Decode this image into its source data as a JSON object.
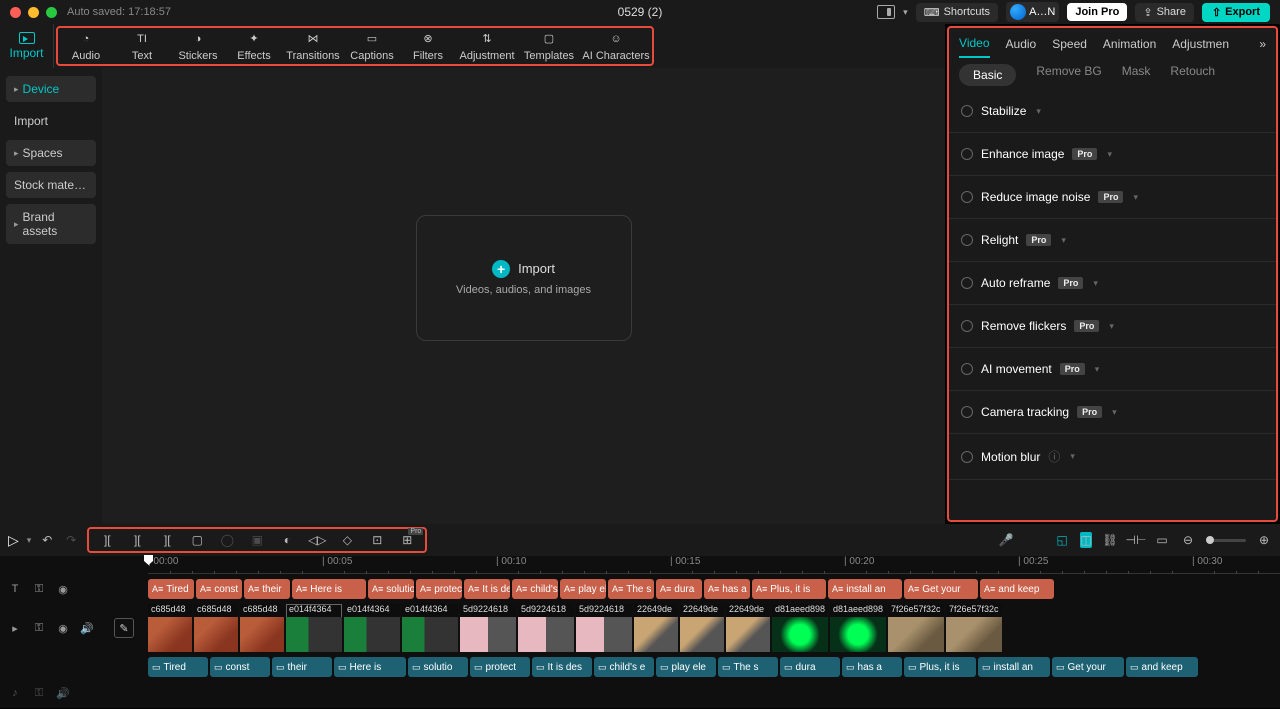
{
  "titlebar": {
    "autosave": "Auto saved: 17:18:57",
    "title": "0529 (2)",
    "shortcuts": "Shortcuts",
    "user": "A…N",
    "joinpro": "Join Pro",
    "share": "Share",
    "export": "Export"
  },
  "ribbon": {
    "import": "Import",
    "items": [
      {
        "label": "Audio"
      },
      {
        "label": "Text"
      },
      {
        "label": "Stickers"
      },
      {
        "label": "Effects"
      },
      {
        "label": "Transitions"
      },
      {
        "label": "Captions"
      },
      {
        "label": "Filters"
      },
      {
        "label": "Adjustment"
      },
      {
        "label": "Templates"
      },
      {
        "label": "AI Characters"
      }
    ]
  },
  "sidebar": {
    "items": [
      {
        "label": "Device",
        "active": true,
        "arrow": true
      },
      {
        "label": "Import",
        "plain": true
      },
      {
        "label": "Spaces",
        "arrow": true
      },
      {
        "label": "Stock mate…"
      },
      {
        "label": "Brand assets",
        "arrow": true
      }
    ]
  },
  "drop": {
    "title": "Import",
    "sub": "Videos, audios, and images"
  },
  "rightpanel": {
    "tabs": [
      "Video",
      "Audio",
      "Speed",
      "Animation",
      "Adjustmen"
    ],
    "subtabs": [
      "Basic",
      "Remove BG",
      "Mask",
      "Retouch"
    ],
    "items": [
      {
        "label": "Stabilize",
        "pro": false
      },
      {
        "label": "Enhance image",
        "pro": true
      },
      {
        "label": "Reduce image noise",
        "pro": true
      },
      {
        "label": "Relight",
        "pro": true
      },
      {
        "label": "Auto reframe",
        "pro": true
      },
      {
        "label": "Remove flickers",
        "pro": true
      },
      {
        "label": "AI movement",
        "pro": true
      },
      {
        "label": "Camera tracking",
        "pro": true
      },
      {
        "label": "Motion blur",
        "pro": false,
        "info": true
      }
    ],
    "pro_label": "Pro"
  },
  "ruler": {
    "marks": [
      "00:00",
      "00:05",
      "00:10",
      "00:15",
      "00:20",
      "00:25",
      "00:30"
    ]
  },
  "tracks": {
    "textClips": [
      "Tired",
      "const",
      "their",
      "Here is",
      "solutio",
      "protec",
      "It is des",
      "child's e",
      "play ele",
      "The s",
      "dura",
      "has a",
      "Plus, it is",
      "install an",
      "Get your",
      "and keep"
    ],
    "videoClips": [
      {
        "id": "c685d48",
        "t": "a"
      },
      {
        "id": "c685d48",
        "t": "a"
      },
      {
        "id": "c685d48",
        "t": "a"
      },
      {
        "id": "e014f4364",
        "t": "b",
        "sel": true
      },
      {
        "id": "e014f4364",
        "t": "b"
      },
      {
        "id": "e014f4364",
        "t": "b"
      },
      {
        "id": "5d9224618",
        "t": "c"
      },
      {
        "id": "5d9224618",
        "t": "c"
      },
      {
        "id": "5d9224618",
        "t": "c"
      },
      {
        "id": "22649de",
        "t": "d"
      },
      {
        "id": "22649de",
        "t": "d"
      },
      {
        "id": "22649de",
        "t": "d"
      },
      {
        "id": "d81aeed898",
        "t": "e"
      },
      {
        "id": "d81aeed898",
        "t": "e"
      },
      {
        "id": "7f26e57f32c",
        "t": "f"
      },
      {
        "id": "7f26e57f32c",
        "t": "f"
      }
    ],
    "subClips": [
      "Tired",
      "const",
      "their",
      "Here is",
      "solutio",
      "protect",
      "It is des",
      "child's e",
      "play ele",
      "The s",
      "dura",
      "has a",
      "Plus, it is",
      "install an",
      "Get your",
      "and keep"
    ]
  }
}
